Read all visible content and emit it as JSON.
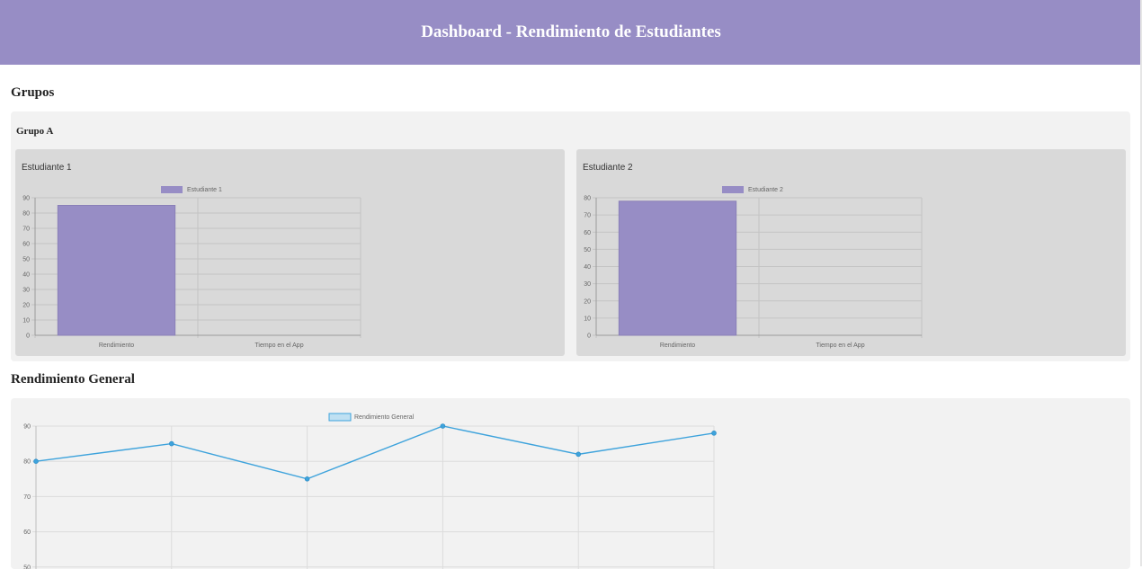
{
  "header": {
    "title": "Dashboard - Rendimiento de Estudiantes"
  },
  "sections": {
    "groups_title": "Grupos",
    "general_title": "Rendimiento General"
  },
  "groups": [
    {
      "name": "Grupo A",
      "students": [
        {
          "title": "Estudiante 1",
          "chart_data": {
            "type": "bar",
            "title": "",
            "categories": [
              "Rendimiento",
              "Tiempo en el App"
            ],
            "series": [
              {
                "name": "Estudiante 1",
                "values": [
                  85,
                  0
                ]
              }
            ],
            "ylim": [
              0,
              90
            ],
            "yticks": [
              0,
              10,
              20,
              30,
              40,
              50,
              60,
              70,
              80,
              90
            ],
            "legend": "top",
            "grid": true,
            "color": "#978dc5"
          }
        },
        {
          "title": "Estudiante 2",
          "chart_data": {
            "type": "bar",
            "title": "",
            "categories": [
              "Rendimiento",
              "Tiempo en el App"
            ],
            "series": [
              {
                "name": "Estudiante 2",
                "values": [
                  78,
                  0
                ]
              }
            ],
            "ylim": [
              0,
              80
            ],
            "yticks": [
              0,
              10,
              20,
              30,
              40,
              50,
              60,
              70,
              80
            ],
            "legend": "top",
            "grid": true,
            "color": "#978dc5"
          }
        }
      ]
    }
  ],
  "general_chart": {
    "chart_data": {
      "type": "line",
      "series": [
        {
          "name": "Rendimiento General",
          "values": [
            80,
            85,
            75,
            90,
            82,
            88
          ]
        }
      ],
      "ylim": [
        50,
        90
      ],
      "yticks": [
        50,
        60,
        70,
        80,
        90
      ],
      "legend": "top",
      "grid": true,
      "color": "#3ea3dc"
    }
  }
}
